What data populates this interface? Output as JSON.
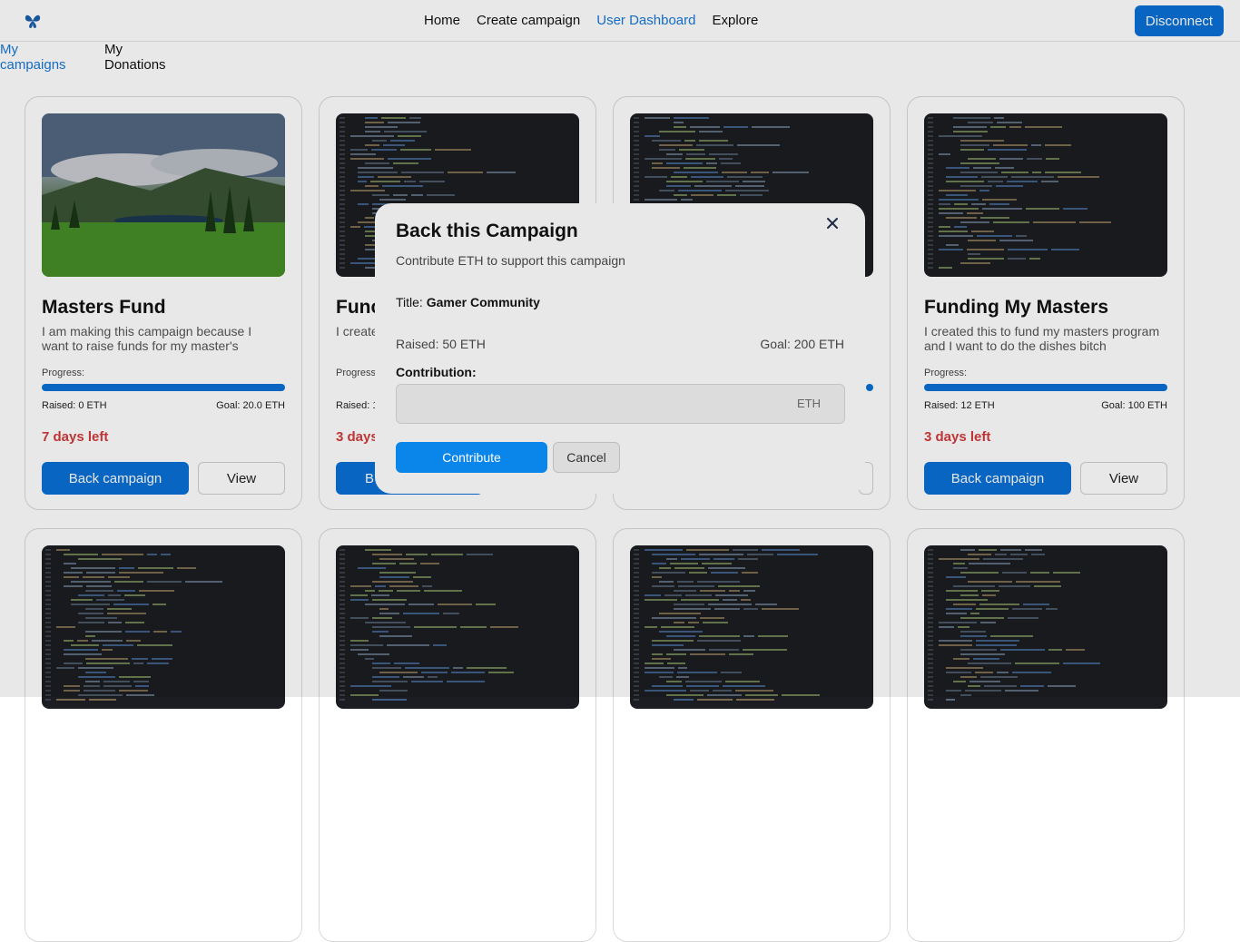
{
  "header": {
    "logo_icon": "butterfly-icon",
    "nav": [
      {
        "label": "Home"
      },
      {
        "label": "Create campaign"
      },
      {
        "label": "User Dashboard",
        "active": true
      },
      {
        "label": "Explore"
      }
    ],
    "disconnect_label": "Disconnect"
  },
  "subtabs": {
    "my_campaigns": "My campaigns",
    "my_donations": "My Donations"
  },
  "cards": [
    {
      "title": "Masters Fund",
      "description": "I am making this campaign because I want to raise funds for my master's",
      "progress_label": "Progress:",
      "raised": "Raised: 0 ETH",
      "goal": "Goal: 20.0 ETH",
      "days_left": "7 days left",
      "back_label": "Back campaign",
      "view_label": "View"
    },
    {
      "title": "Func",
      "description": "I create and I w",
      "progress_label": "Progress",
      "raised": "Raised: 1",
      "goal": "",
      "days_left": "3 days",
      "back_label": "B",
      "view_label": ""
    },
    {
      "title": "",
      "description": "",
      "progress_label": "",
      "raised": "",
      "goal": "",
      "days_left": "",
      "back_label": "",
      "view_label": ""
    },
    {
      "title": "Funding My Masters",
      "description": "I created this to fund my masters program and I want to do the dishes bitch",
      "progress_label": "Progress:",
      "raised": "Raised: 12 ETH",
      "goal": "Goal: 100 ETH",
      "days_left": "3 days left",
      "back_label": "Back campaign",
      "view_label": "View"
    }
  ],
  "modal": {
    "title": "Back this Campaign",
    "subtitle": "Contribute ETH to support this campaign",
    "close_icon": "close-icon",
    "campaign_title_label": "Title:",
    "campaign_title_value": "Gamer Community",
    "raised": "Raised: 50 ETH",
    "goal": "Goal: 200 ETH",
    "contribution_label": "Contribution:",
    "contribution_value": "",
    "unit": "ETH",
    "contribute_label": "Contribute",
    "cancel_label": "Cancel"
  }
}
